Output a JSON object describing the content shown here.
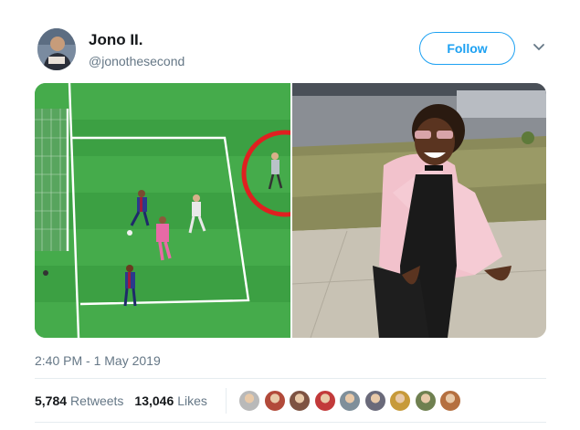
{
  "tweet": {
    "author": {
      "name": "Jono II.",
      "handle": "@jonothesecond"
    },
    "follow_label": "Follow",
    "timestamp": "2:40 PM - 1 May 2019",
    "stats": {
      "retweets_count": "5,784",
      "retweets_label": "Retweets",
      "likes_count": "13,046",
      "likes_label": "Likes"
    },
    "liker_avatar_colors": [
      "#b9b9b9",
      "#b24a3a",
      "#7e5342",
      "#c23a3a",
      "#7f8f9a",
      "#6a6a7a",
      "#c79a3a",
      "#6f8050",
      "#b57040"
    ]
  },
  "icons": {
    "more": "chevron-down-icon"
  },
  "colors": {
    "accent": "#1da1f2",
    "secondary_text": "#657786",
    "divider": "#e6ecf0",
    "pitch": "#3ca043",
    "highlight_circle": "#e02020"
  }
}
